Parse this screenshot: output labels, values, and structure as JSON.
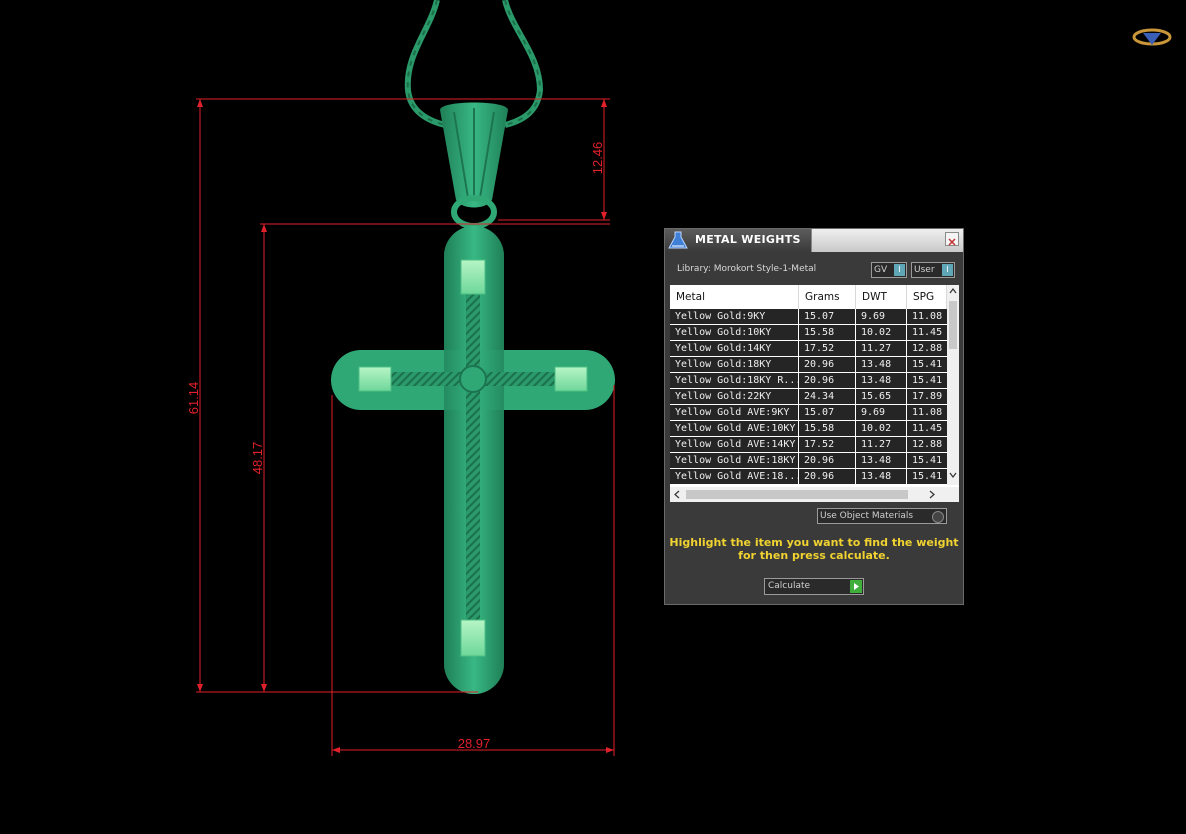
{
  "viewport": {
    "dimensions": {
      "total_height": "61.14",
      "body_height": "48.17",
      "bail_height": "12.46",
      "width": "28.97"
    },
    "model_color": "#2fa875",
    "dimension_color": "#e0202a"
  },
  "panel": {
    "title": "METAL WEIGHTS",
    "library_label": "Library: Morokort Style-1-Metal",
    "gv_toggle": {
      "label": "GV",
      "knob": "I"
    },
    "user_toggle": {
      "label": "User",
      "knob": "I"
    },
    "table": {
      "columns": [
        "Metal",
        "Grams",
        "DWT",
        "SPG"
      ],
      "rows": [
        [
          "Yellow Gold:9KY",
          "15.07",
          "9.69",
          "11.08"
        ],
        [
          "Yellow Gold:10KY",
          "15.58",
          "10.02",
          "11.45"
        ],
        [
          "Yellow Gold:14KY",
          "17.52",
          "11.27",
          "12.88"
        ],
        [
          "Yellow Gold:18KY",
          "20.96",
          "13.48",
          "15.41"
        ],
        [
          "Yellow Gold:18KY R...",
          "20.96",
          "13.48",
          "15.41"
        ],
        [
          "Yellow Gold:22KY",
          "24.34",
          "15.65",
          "17.89"
        ],
        [
          "Yellow Gold AVE:9KY",
          "15.07",
          "9.69",
          "11.08"
        ],
        [
          "Yellow Gold AVE:10KY",
          "15.58",
          "10.02",
          "11.45"
        ],
        [
          "Yellow Gold AVE:14KY",
          "17.52",
          "11.27",
          "12.88"
        ],
        [
          "Yellow Gold AVE:18KY",
          "20.96",
          "13.48",
          "15.41"
        ],
        [
          "Yellow Gold AVE:18...",
          "20.96",
          "13.48",
          "15.41"
        ]
      ]
    },
    "use_object_materials": "Use Object Materials",
    "message_line1": "Highlight the item you want to find the weight",
    "message_line2": "for then press calculate.",
    "calculate_label": "Calculate"
  }
}
